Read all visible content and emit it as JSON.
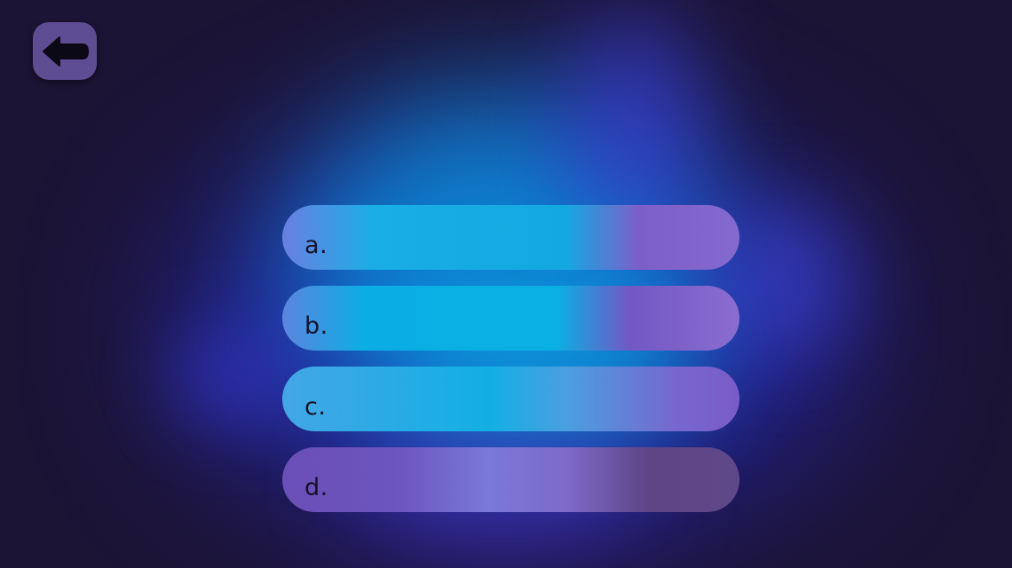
{
  "back_button": {
    "icon": "arrow-left-icon"
  },
  "options": [
    {
      "label": "a."
    },
    {
      "label": "b."
    },
    {
      "label": "c."
    },
    {
      "label": "d."
    }
  ],
  "colors": {
    "background": "#1c1435",
    "back_button": "#5f4d94",
    "option_text": "#14122a",
    "glow_cyan": "#0a8fd8",
    "glow_blue": "#2a2bd6"
  }
}
